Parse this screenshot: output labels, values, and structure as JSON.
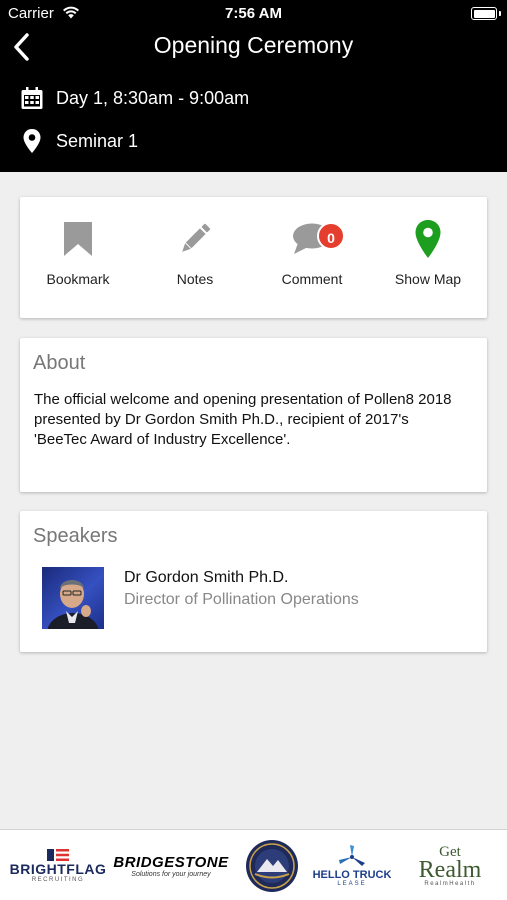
{
  "status_bar": {
    "carrier": "Carrier",
    "time": "7:56 AM"
  },
  "header": {
    "title": "Opening Ceremony",
    "time_text": "Day 1, 8:30am - 9:00am",
    "venue_text": "Seminar 1"
  },
  "actions": {
    "bookmark_label": "Bookmark",
    "notes_label": "Notes",
    "comment_label": "Comment",
    "comment_count": "0",
    "map_label": "Show Map"
  },
  "about": {
    "heading": "About",
    "text": "The official welcome and opening presentation of Pollen8 2018 presented by Dr Gordon Smith Ph.D., recipient of 2017's 'BeeTec Award of Industry Excellence'."
  },
  "speakers": {
    "heading": "Speakers",
    "items": [
      {
        "name": "Dr Gordon Smith Ph.D.",
        "role": "Director of Pollination Operations"
      }
    ]
  },
  "sponsors": {
    "brightflag": {
      "name": "BRIGHTFLAG",
      "sub": "RECRUITING"
    },
    "bridgestone": {
      "name": "BRIDGESTONE",
      "sub": "Solutions for your journey"
    },
    "hellotruck": {
      "name": "HELLO TRUCK",
      "sub": "LEASE"
    },
    "getrealm": {
      "top": "Get",
      "name": "Realm",
      "sub": "RealmHealth"
    }
  },
  "colors": {
    "header_bg": "#000000",
    "map_pin": "#1e9e1e",
    "badge": "#e53d2e",
    "icon_gray": "#9a9a9a"
  },
  "icons": {
    "back": "chevron-left-icon",
    "calendar": "calendar-icon",
    "location": "location-pin-icon",
    "bookmark": "bookmark-icon",
    "notes": "pencil-icon",
    "comment": "speech-bubble-icon",
    "map": "map-pin-icon"
  }
}
